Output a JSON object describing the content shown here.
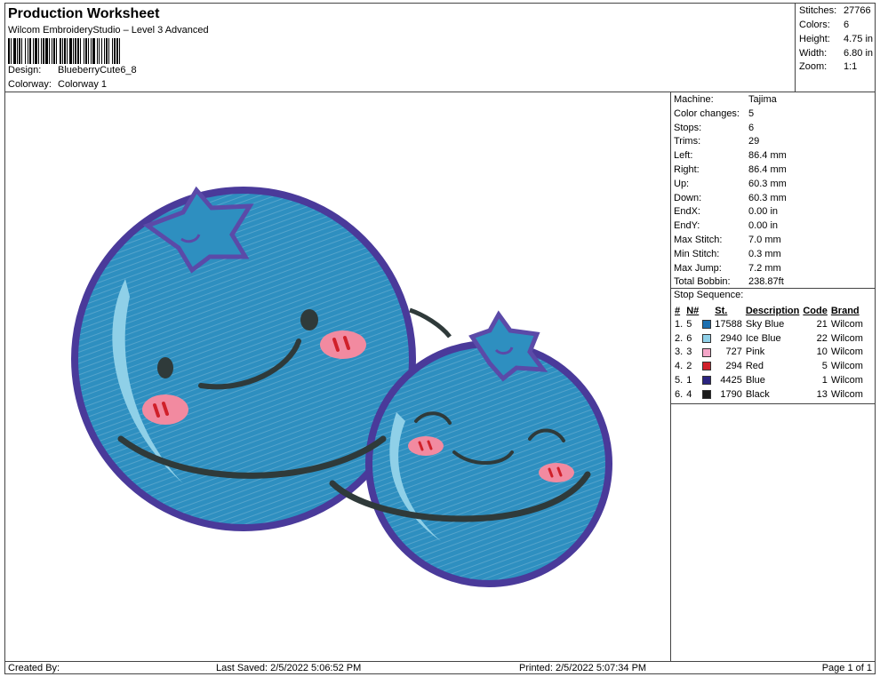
{
  "header": {
    "title": "Production Worksheet",
    "subtitle": "Wilcom EmbroideryStudio – Level 3 Advanced",
    "design_label": "Design:",
    "design_value": "BlueberryCute6_8",
    "colorway_label": "Colorway:",
    "colorway_value": "Colorway 1"
  },
  "summary": [
    {
      "label": "Stitches:",
      "value": "27766"
    },
    {
      "label": "Colors:",
      "value": "6"
    },
    {
      "label": "Height:",
      "value": "4.75 in"
    },
    {
      "label": "Width:",
      "value": "6.80 in"
    },
    {
      "label": "Zoom:",
      "value": "1:1"
    }
  ],
  "machine_info": [
    {
      "label": "Machine:",
      "value": "Tajima"
    },
    {
      "label": "Color changes:",
      "value": "5"
    },
    {
      "label": "Stops:",
      "value": "6"
    },
    {
      "label": "Trims:",
      "value": "29"
    },
    {
      "label": "Left:",
      "value": "86.4 mm"
    },
    {
      "label": "Right:",
      "value": "86.4 mm"
    },
    {
      "label": "Up:",
      "value": "60.3 mm"
    },
    {
      "label": "Down:",
      "value": "60.3 mm"
    },
    {
      "label": "EndX:",
      "value": "0.00 in"
    },
    {
      "label": "EndY:",
      "value": "0.00 in"
    },
    {
      "label": "Max Stitch:",
      "value": "7.0 mm"
    },
    {
      "label": "Min Stitch:",
      "value": "0.3 mm"
    },
    {
      "label": "Max Jump:",
      "value": "7.2 mm"
    },
    {
      "label": "Total Bobbin:",
      "value": "238.87ft"
    }
  ],
  "stop_sequence": {
    "label": "Stop Sequence:",
    "headers": [
      "#",
      "N#",
      "St.",
      "Description",
      "Code",
      "Brand"
    ],
    "rows": [
      {
        "idx": "1.",
        "stop": "5",
        "color": "#1c6fb0",
        "st": "17588",
        "desc": "Sky Blue",
        "code": "21",
        "brand": "Wilcom"
      },
      {
        "idx": "2.",
        "stop": "6",
        "color": "#8fd0e8",
        "st": "2940",
        "desc": "Ice Blue",
        "code": "22",
        "brand": "Wilcom"
      },
      {
        "idx": "3.",
        "stop": "3",
        "color": "#f4a6c8",
        "st": "727",
        "desc": "Pink",
        "code": "10",
        "brand": "Wilcom"
      },
      {
        "idx": "4.",
        "stop": "2",
        "color": "#d0202a",
        "st": "294",
        "desc": "Red",
        "code": "5",
        "brand": "Wilcom"
      },
      {
        "idx": "5.",
        "stop": "1",
        "color": "#2a2480",
        "st": "4425",
        "desc": "Blue",
        "code": "1",
        "brand": "Wilcom"
      },
      {
        "idx": "6.",
        "stop": "4",
        "color": "#1a1a1a",
        "st": "1790",
        "desc": "Black",
        "code": "13",
        "brand": "Wilcom"
      }
    ]
  },
  "footer": {
    "created_by": "Created By:",
    "last_saved": "Last Saved: 2/5/2022 5:06:52 PM",
    "printed": "Printed: 2/5/2022 5:07:34 PM",
    "page": "Page 1 of 1"
  },
  "design_colors": {
    "fill": "#2e8fc0",
    "outline": "#4a3a9a",
    "highlight": "#8fd0e8",
    "stem": "#5b4aa8",
    "cheek": "#f28aa0",
    "cheek_mark": "#d0202a",
    "mouth": "#2f3a3a"
  }
}
